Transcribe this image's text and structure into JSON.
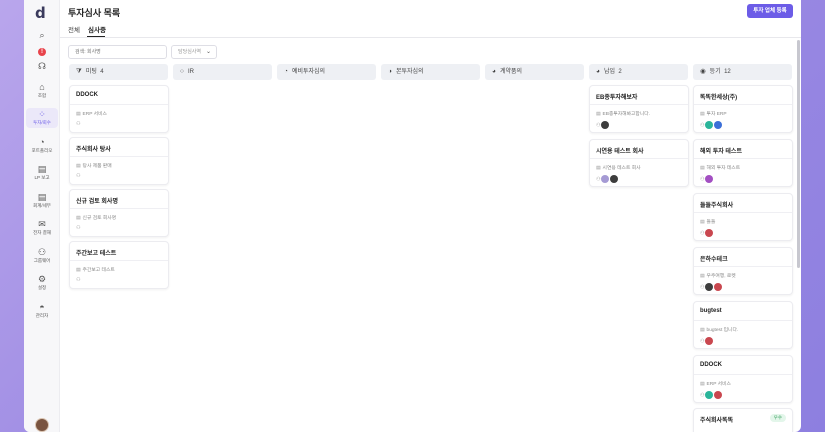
{
  "app": {
    "logo": "d",
    "title": "투자심사 목록",
    "register_button": "투자 업체 등록"
  },
  "sidebar": {
    "icons": [
      {
        "name": "search-icon",
        "glyph": "⌕"
      },
      {
        "name": "alert-icon",
        "glyph": "!"
      },
      {
        "name": "headset-icon",
        "glyph": "☊"
      }
    ],
    "items": [
      {
        "label": "조합",
        "icon": "home-icon",
        "glyph": "⌂",
        "active": false
      },
      {
        "label": "투자/회수",
        "icon": "grid-icon",
        "glyph": "⁘",
        "active": true
      },
      {
        "label": "포트폴리오",
        "icon": "pie-chart-icon",
        "glyph": "◔",
        "active": false
      },
      {
        "label": "LP 보고",
        "icon": "document-icon",
        "glyph": "▤",
        "active": false
      },
      {
        "label": "회계/세무",
        "icon": "report-icon",
        "glyph": "▤",
        "active": false
      },
      {
        "label": "전자 결재",
        "icon": "mail-icon",
        "glyph": "✉",
        "active": false
      },
      {
        "label": "그룹웨어",
        "icon": "users-icon",
        "glyph": "⚇",
        "active": false
      },
      {
        "label": "설정",
        "icon": "gear-icon",
        "glyph": "⚙",
        "active": false
      },
      {
        "label": "관리자",
        "icon": "admin-icon",
        "glyph": "◓",
        "active": false
      }
    ]
  },
  "tabs": [
    {
      "label": "전체",
      "active": false
    },
    {
      "label": "심사중",
      "active": true
    }
  ],
  "search": {
    "placeholder": "검색: 회사명"
  },
  "filter": {
    "label": "담당심사역"
  },
  "columns": [
    {
      "label": "미팅",
      "count": "4",
      "icon": "funnel-icon",
      "glyph": "⧩"
    },
    {
      "label": "IR",
      "count": "",
      "icon": "circle-icon",
      "glyph": "○"
    },
    {
      "label": "예비투자심의",
      "count": "",
      "icon": "circle-quarter-icon",
      "glyph": "◔"
    },
    {
      "label": "본투자심의",
      "count": "",
      "icon": "circle-half-icon",
      "glyph": "◑"
    },
    {
      "label": "계약품의",
      "count": "",
      "icon": "circle-three-quarter-icon",
      "glyph": "◕"
    },
    {
      "label": "납입",
      "count": "2",
      "icon": "circle-full-icon",
      "glyph": "◕"
    },
    {
      "label": "등기",
      "count": "12",
      "icon": "target-icon",
      "glyph": "◉"
    }
  ],
  "cards": {
    "meeting": [
      {
        "title": "DDOCK",
        "desc": "ERP 서비스",
        "people": []
      },
      {
        "title": "주식회사 탕사",
        "desc": "탕사 제품 판매",
        "people": []
      },
      {
        "title": "신규 검토 회사명",
        "desc": "신규 검토 회사명",
        "people": []
      },
      {
        "title": "주간보고 테스트",
        "desc": "주간보고 테스트",
        "people": []
      }
    ],
    "payment": [
      {
        "title": "EB종투자해보자",
        "desc": "EB종투자해봐고합니다.",
        "people": [
          "#3d3d3d"
        ]
      },
      {
        "title": "시연용 테스트 회사",
        "desc": "시연용 테스트 회사",
        "people": [
          "#a59ad4",
          "#3d3d3d"
        ]
      }
    ],
    "registry": [
      {
        "title": "똑똑한세상(주)",
        "desc": "투자 ERP",
        "people": [
          "#2bb59a",
          "#3b6fd8"
        ],
        "badge": ""
      },
      {
        "title": "해외 투자 테스트",
        "desc": "해외 투자 테스트",
        "people": [
          "#a34fc2"
        ],
        "badge": ""
      },
      {
        "title": "들들주식회사",
        "desc": "들들",
        "people": [
          "#c9474f"
        ],
        "badge": ""
      },
      {
        "title": "은하수테크",
        "desc": "우주여행, 로켓",
        "people": [
          "#3d3d3d",
          "#c9474f"
        ],
        "badge": ""
      },
      {
        "title": "bugtest",
        "desc": "bugtest 입니다.",
        "people": [
          "#c9474f"
        ],
        "badge": ""
      },
      {
        "title": "DDOCK",
        "desc": "ERP 서비스",
        "people": [
          "#2bb59a",
          "#c9474f"
        ],
        "badge": ""
      },
      {
        "title": "주식회사똑똑",
        "desc": "",
        "people": [],
        "badge": "우수"
      }
    ]
  }
}
